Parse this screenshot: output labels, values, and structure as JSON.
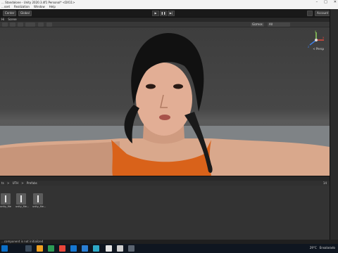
{
  "window": {
    "title": "... Standalone - Unity 2020.3.4f1 Personal* <DX11>",
    "controls": [
      "–",
      "□",
      "✕"
    ]
  },
  "menu": [
    "...sset",
    "Realization",
    "Window",
    "Help"
  ],
  "toolbar": {
    "left_buttons": [
      "Center",
      "Global"
    ],
    "play": "▶",
    "pause": "❚❚",
    "step": "▶|",
    "account": "Account"
  },
  "tabs": [
    "Hi",
    "Scene"
  ],
  "scene": {
    "shading": "Shaded",
    "gizmos": "Gizmos",
    "all": "All",
    "persp_label": "< Persp",
    "gizmo_axes": {
      "y": "y",
      "x": "x",
      "z": "z"
    },
    "colors": {
      "x": "#e0483c",
      "y": "#8fd05a",
      "z": "#3f7ce0"
    }
  },
  "project": {
    "crumbs": [
      "ts",
      ">",
      "UTH",
      ">",
      "Prefabs"
    ],
    "assets": [
      "unity_file",
      "unity_file...",
      "unity_file..."
    ],
    "count": "14"
  },
  "status": "...component is not initialized",
  "taskbar": {
    "temp": "29°C",
    "weather": "Ensolarado"
  }
}
